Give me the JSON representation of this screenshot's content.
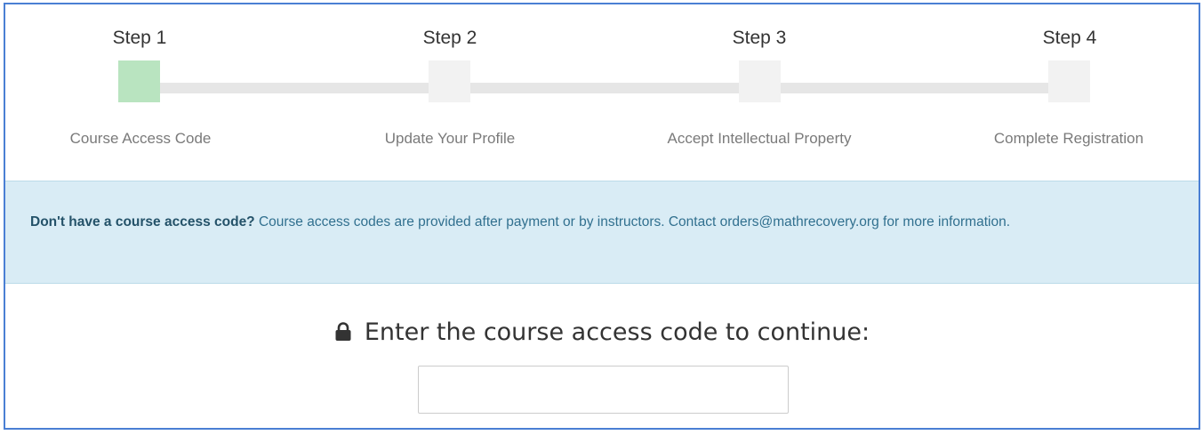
{
  "wizard": {
    "steps": [
      {
        "title": "Step 1",
        "label": "Course Access Code",
        "state": "active"
      },
      {
        "title": "Step 2",
        "label": "Update Your Profile",
        "state": "pending"
      },
      {
        "title": "Step 3",
        "label": "Accept Intellectual Property",
        "state": "pending"
      },
      {
        "title": "Step 4",
        "label": "Complete Registration",
        "state": "pending"
      }
    ],
    "active_color": "#b9e4c0",
    "pending_color": "#f2f2f2"
  },
  "notice": {
    "bold": "Don't have a course access code?",
    "text": " Course access codes are provided after payment or by instructors. Contact orders@mathrecovery.org for more information."
  },
  "access": {
    "icon": "lock-icon",
    "prompt": "Enter the course access code to continue:",
    "value": "",
    "placeholder": ""
  },
  "colors": {
    "border": "#4a7fd4",
    "info_bg": "#d9ecf5"
  }
}
